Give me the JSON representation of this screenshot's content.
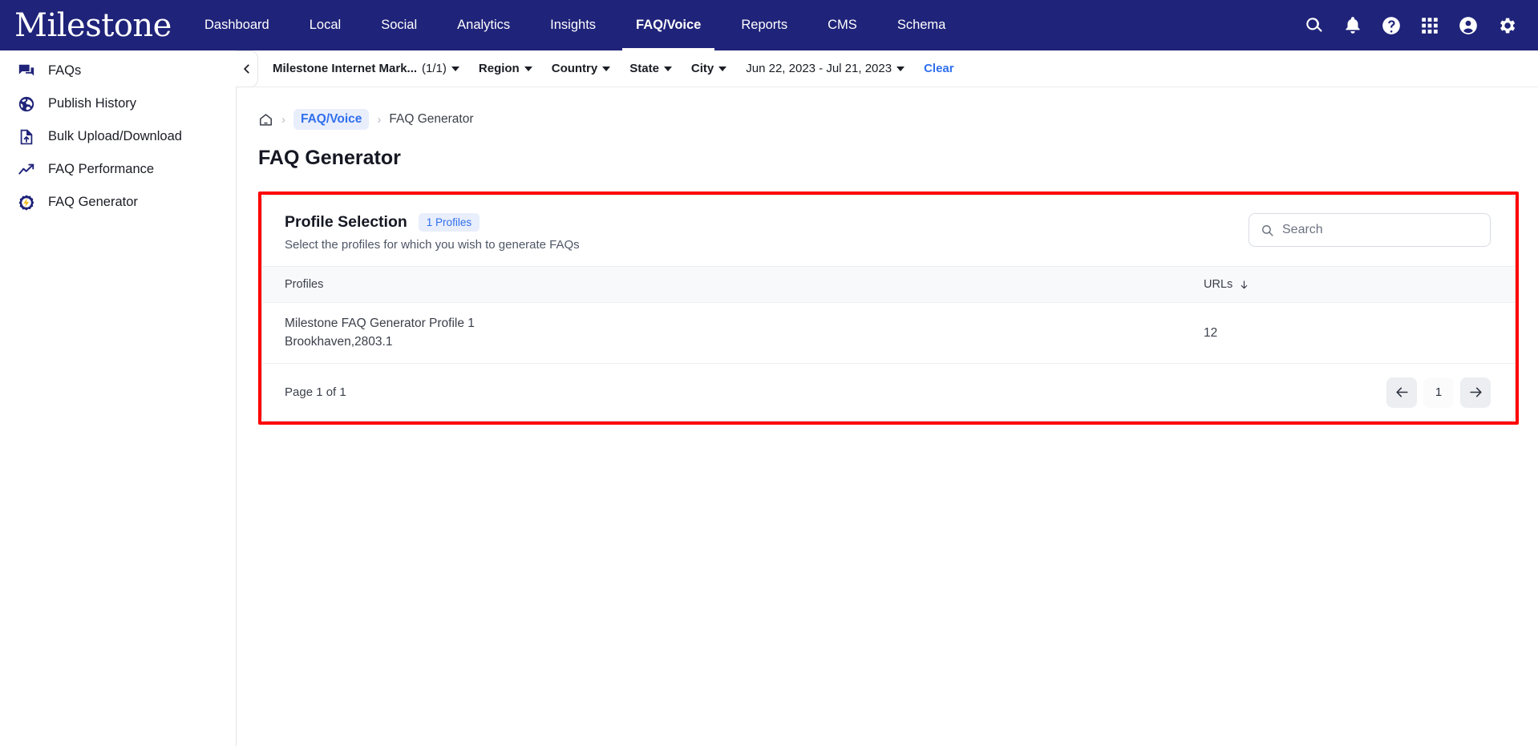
{
  "topnav": {
    "brand": "Milestone",
    "items": [
      {
        "label": "Dashboard",
        "active": false
      },
      {
        "label": "Local",
        "active": false
      },
      {
        "label": "Social",
        "active": false
      },
      {
        "label": "Analytics",
        "active": false
      },
      {
        "label": "Insights",
        "active": false
      },
      {
        "label": "FAQ/Voice",
        "active": true
      },
      {
        "label": "Reports",
        "active": false
      },
      {
        "label": "CMS",
        "active": false
      },
      {
        "label": "Schema",
        "active": false
      }
    ],
    "icons": [
      "search-icon",
      "bell-icon",
      "help-icon",
      "apps-grid-icon",
      "account-icon",
      "settings-gear-icon"
    ],
    "background_color": "#1f2379"
  },
  "sidebar": {
    "items": [
      {
        "label": "FAQs",
        "icon": "chat-bubbles-icon"
      },
      {
        "label": "Publish History",
        "icon": "globe-icon"
      },
      {
        "label": "Bulk Upload/Download",
        "icon": "file-upload-icon"
      },
      {
        "label": "FAQ Performance",
        "icon": "trending-up-icon"
      },
      {
        "label": "FAQ Generator",
        "icon": "gear-bolt-icon"
      }
    ]
  },
  "filterbar": {
    "collapse_icon": "chevron-left-icon",
    "account": "Milestone Internet Mark...",
    "account_count": "(1/1)",
    "region": "Region",
    "country": "Country",
    "state": "State",
    "city": "City",
    "date_range": "Jun 22, 2023 - Jul 21, 2023",
    "clear": "Clear"
  },
  "breadcrumb": {
    "home_icon": "home-icon",
    "separator": "›",
    "link": "FAQ/Voice",
    "current": "FAQ Generator"
  },
  "page": {
    "title": "FAQ Generator"
  },
  "card": {
    "title": "Profile Selection",
    "badge": "1 Profiles",
    "subtitle": "Select the profiles for which you wish to generate FAQs",
    "highlight_color": "#ff0000",
    "search": {
      "placeholder": "Search",
      "value": "",
      "icon": "search-icon"
    },
    "table": {
      "columns": [
        "Profiles",
        "URLs"
      ],
      "sort_column": "URLs",
      "sort_direction": "descending",
      "rows": [
        {
          "profile_name": "Milestone FAQ Generator Profile 1",
          "profile_sub": "Brookhaven,2803.1",
          "urls": "12"
        }
      ]
    },
    "footer": {
      "page_text": "Page 1 of 1",
      "prev_icon": "arrow-left-icon",
      "current_page": "1",
      "next_icon": "arrow-right-icon"
    }
  }
}
